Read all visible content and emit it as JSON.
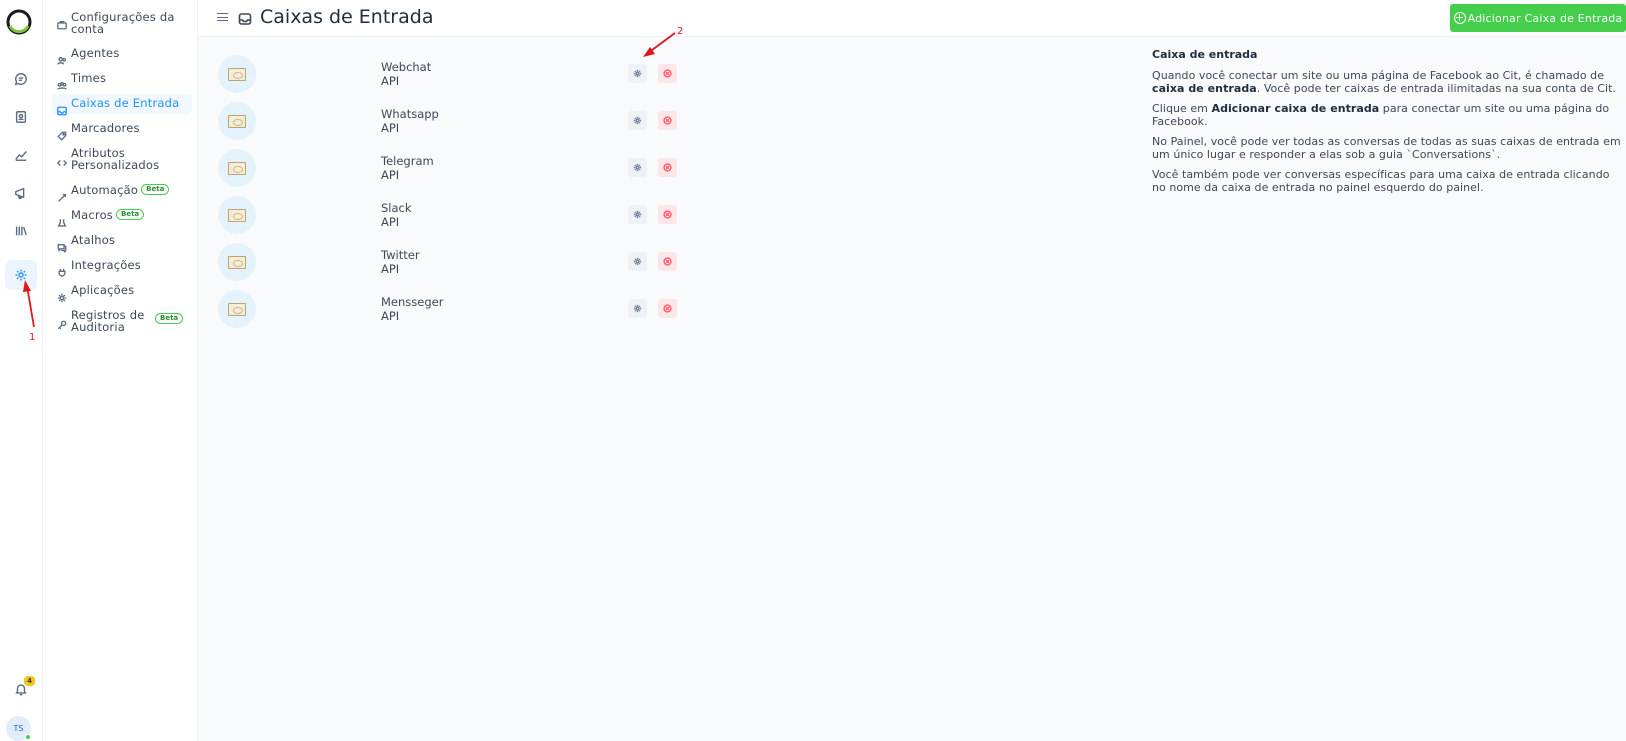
{
  "header": {
    "title": "Caixas de Entrada",
    "add_button": "Adicionar Caixa de Entrada"
  },
  "rail": {
    "notification_count": "4",
    "avatar_initials": "TS"
  },
  "sidebar": {
    "items": [
      {
        "label": "Configurações da conta",
        "icon": "briefcase-icon"
      },
      {
        "label": "Agentes",
        "icon": "people-icon"
      },
      {
        "label": "Times",
        "icon": "team-icon"
      },
      {
        "label": "Caixas de Entrada",
        "icon": "inbox-icon",
        "active": true
      },
      {
        "label": "Marcadores",
        "icon": "tag-icon"
      },
      {
        "label": "Atributos Personalizados",
        "icon": "code-icon"
      },
      {
        "label": "Automação",
        "icon": "automation-icon",
        "badge": "Beta"
      },
      {
        "label": "Macros",
        "icon": "macro-icon",
        "badge": "Beta"
      },
      {
        "label": "Atalhos",
        "icon": "chat-shortcut-icon"
      },
      {
        "label": "Integrações",
        "icon": "plug-icon"
      },
      {
        "label": "Aplicações",
        "icon": "apps-icon"
      },
      {
        "label": "Registros de Auditoria",
        "icon": "key-icon",
        "badge": "Beta"
      }
    ]
  },
  "inboxes": [
    {
      "name": "Webchat",
      "type": "API"
    },
    {
      "name": "Whatsapp",
      "type": "API"
    },
    {
      "name": "Telegram",
      "type": "API"
    },
    {
      "name": "Slack",
      "type": "API"
    },
    {
      "name": "Twitter",
      "type": "API"
    },
    {
      "name": "Mensseger",
      "type": "API"
    }
  ],
  "help": {
    "title": "Caixa de entrada",
    "p1_a": "Quando você conectar um site ou uma página de Facebook ao Cit, é chamado de ",
    "p1_b": "caixa de entrada",
    "p1_c": ". Você pode ter caixas de entrada ilimitadas na sua conta de Cit.",
    "p2_a": "Clique em ",
    "p2_b": "Adicionar caixa de entrada",
    "p2_c": " para conectar um site ou uma página do Facebook.",
    "p3": "No Painel, você pode ver todas as conversas de todas as suas caixas de entrada em um único lugar e responder a elas sob a guia `Conversations`.",
    "p4": "Você também pode ver conversas específicas para uma caixa de entrada clicando no nome da caixa de entrada no painel esquerdo do painel."
  },
  "annotations": {
    "label_1": "1",
    "label_2": "2",
    "color": "#e0161d"
  }
}
